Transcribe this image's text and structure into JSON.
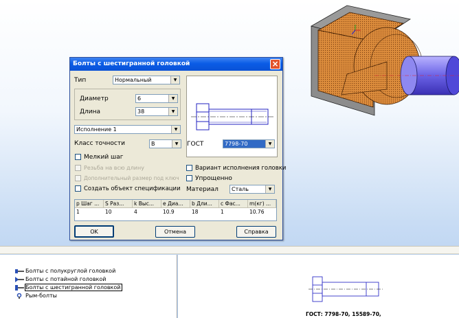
{
  "dialog": {
    "title": "Болты с шестигранной головкой",
    "type": {
      "label": "Тип",
      "value": "Нормальный"
    },
    "diameter": {
      "label": "Диаметр",
      "value": "6"
    },
    "length": {
      "label": "Длина",
      "value": "38"
    },
    "execution": {
      "value": "Исполнение 1"
    },
    "accuracy": {
      "label": "Класс точности",
      "value": "B"
    },
    "gost": {
      "label": "ГОСТ",
      "value": "7798-70"
    },
    "checkboxes": {
      "fine_pitch": "Мелкий шаг",
      "full_thread": "Резьба на всю длину",
      "extra_size": "Дополнительный размер под ключ",
      "spec_object": "Создать объект спецификации",
      "head_variant": "Вариант исполнения головки",
      "simplified": "Упрощенно"
    },
    "material": {
      "label": "Материал",
      "value": "Сталь"
    },
    "table": {
      "headers": [
        "p Шаг ...",
        "S Раз...",
        "k Выс...",
        "e Диа...",
        "b Дли...",
        "c Фас...",
        "m(кг) ..."
      ],
      "row": [
        "1",
        "10",
        "4",
        "10.9",
        "18",
        "1",
        "10.76"
      ]
    },
    "buttons": {
      "ok": "OK",
      "cancel": "Отмена",
      "help": "Справка"
    }
  },
  "library_tree": {
    "items": [
      {
        "label": "Болты с полукруглой головкой",
        "selected": false
      },
      {
        "label": "Болты с потайной головкой",
        "selected": false
      },
      {
        "label": "Болты с шестигранной головкой",
        "selected": true
      },
      {
        "label": "Рым-болты",
        "selected": false
      }
    ]
  },
  "preview_panel": {
    "gost_text": "ГОСТ: 7798-70, 15589-70,"
  },
  "colors": {
    "title_bar": "#0a5ce6",
    "selection": "#2a50b6",
    "model_body": "#d9883a",
    "model_shaft": "#7a72e6"
  }
}
